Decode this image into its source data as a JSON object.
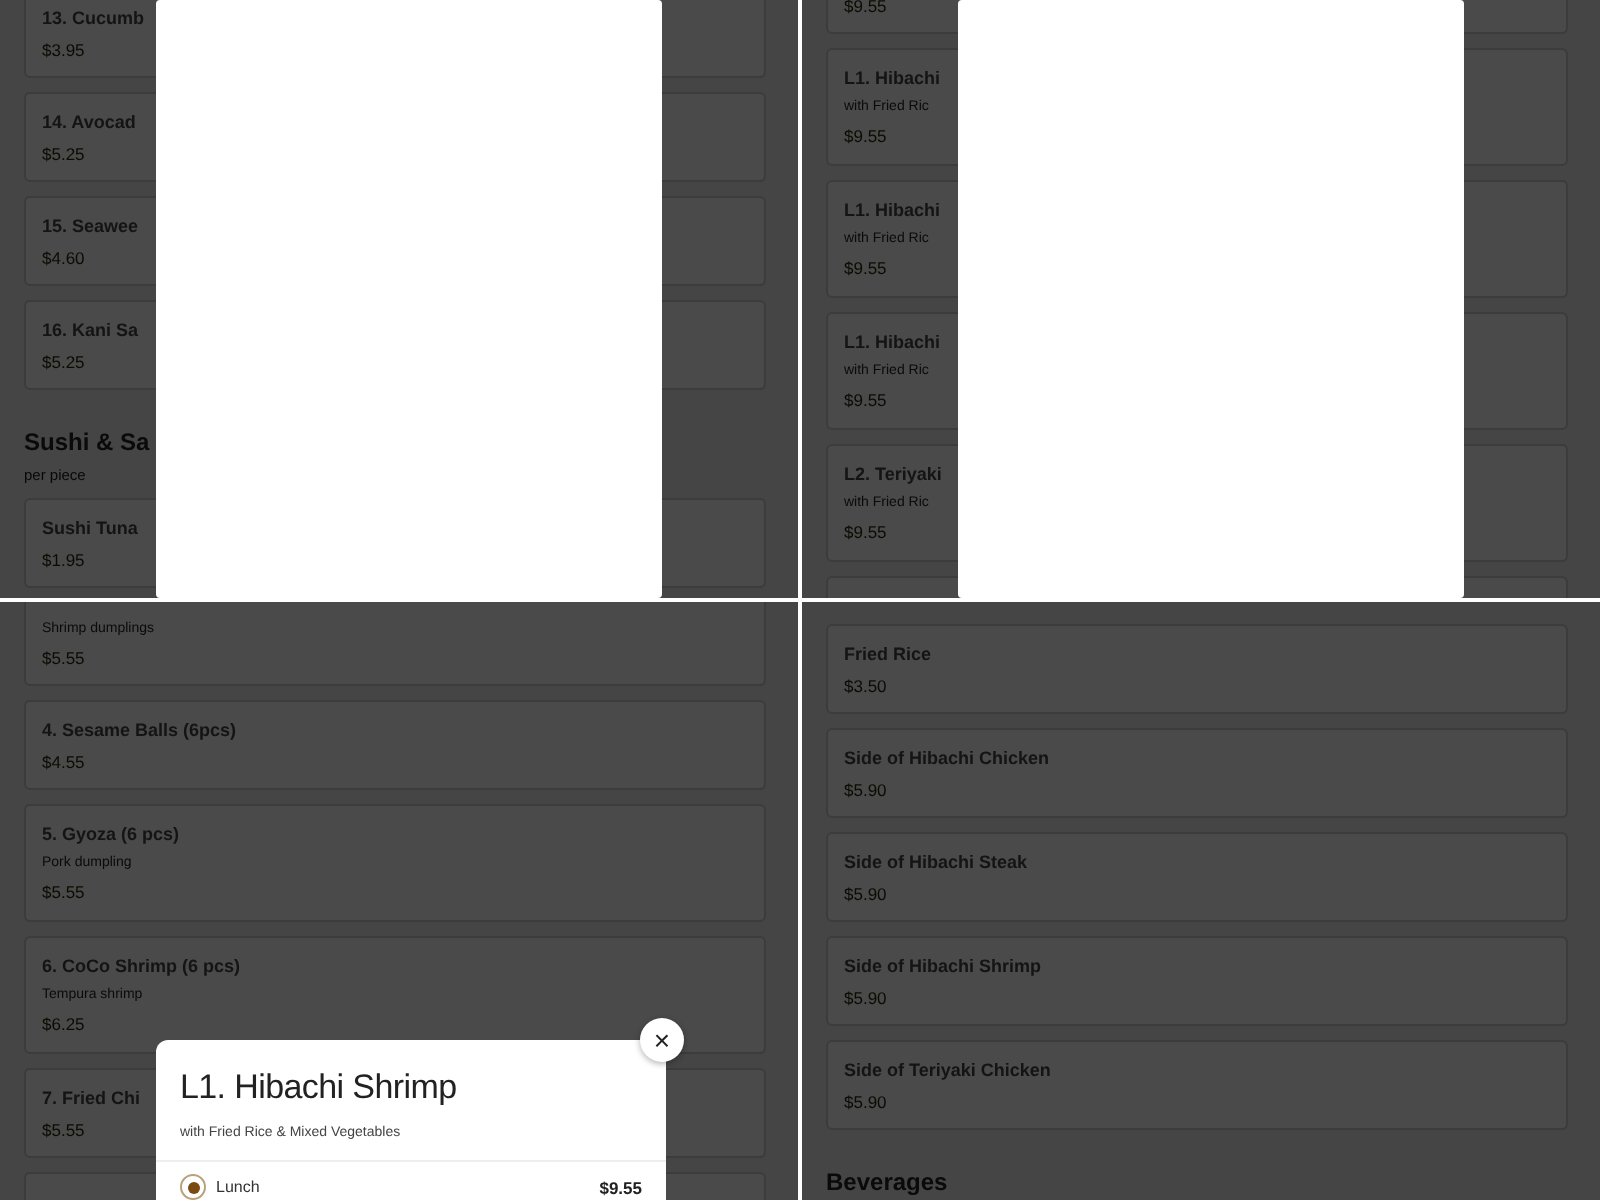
{
  "panels": [
    {
      "items": [
        {
          "kind": "card",
          "title": "13. Cucumb",
          "price": "$3.95"
        },
        {
          "kind": "card",
          "title": "14. Avocad",
          "price": "$5.25"
        },
        {
          "kind": "card",
          "title": "15. Seawee",
          "price": "$4.60"
        },
        {
          "kind": "card",
          "title": "16. Kani Sa",
          "price": "$5.25"
        },
        {
          "kind": "section",
          "title": "Sushi & Sa",
          "note": "per piece"
        },
        {
          "kind": "card",
          "title": "Sushi Tuna",
          "price": "$1.95"
        }
      ],
      "modal": {
        "kind": "blank"
      }
    },
    {
      "items": [
        {
          "kind": "card",
          "price": "$9.55"
        },
        {
          "kind": "card",
          "title": "L1. Hibachi",
          "description": "with Fried Ric",
          "price": "$9.55"
        },
        {
          "kind": "card",
          "title": "L1. Hibachi",
          "description": "with Fried Ric",
          "price": "$9.55"
        },
        {
          "kind": "card",
          "title": "L1. Hibachi",
          "description": "with Fried Ric",
          "price": "$9.55"
        },
        {
          "kind": "card",
          "title": "L2. Teriyaki",
          "description": "with Fried Ric",
          "price": "$9.55"
        },
        {
          "kind": "card"
        }
      ],
      "modal": {
        "kind": "blank"
      }
    },
    {
      "items": [
        {
          "kind": "card",
          "description": "Shrimp dumplings",
          "price": "$5.55"
        },
        {
          "kind": "card",
          "title": "4. Sesame Balls (6pcs)",
          "price": "$4.55"
        },
        {
          "kind": "card",
          "title": "5. Gyoza (6 pcs)",
          "description": "Pork dumpling",
          "price": "$5.55"
        },
        {
          "kind": "card",
          "title": "6. CoCo Shrimp (6 pcs)",
          "description": "Tempura shrimp",
          "price": "$6.25"
        },
        {
          "kind": "card",
          "title": "7. Fried Chi",
          "price": "$5.55"
        },
        {
          "kind": "card"
        }
      ],
      "modal": {
        "kind": "detail",
        "title": "L1. Hibachi Shrimp",
        "subtitle": "with Fried Rice & Mixed Vegetables",
        "close": "×",
        "options": [
          {
            "label": "Lunch",
            "price": "$9.55",
            "selected": true
          }
        ]
      }
    },
    {
      "items": [
        {
          "kind": "card",
          "title": "Fried Rice",
          "price": "$3.50"
        },
        {
          "kind": "card",
          "title": "Side of Hibachi Chicken",
          "price": "$5.90"
        },
        {
          "kind": "card",
          "title": "Side of Hibachi Steak",
          "price": "$5.90"
        },
        {
          "kind": "card",
          "title": "Side of Hibachi Shrimp",
          "price": "$5.90"
        },
        {
          "kind": "card",
          "title": "Side of Teriyaki Chicken",
          "price": "$5.90"
        },
        {
          "kind": "section",
          "title": "Beverages"
        }
      ],
      "modal": {
        "kind": "none"
      }
    }
  ]
}
